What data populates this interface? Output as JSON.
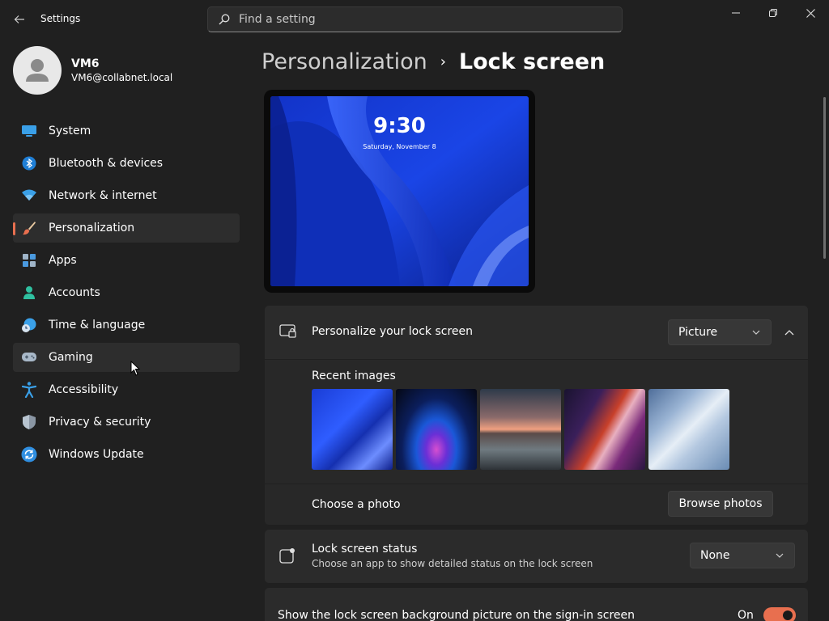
{
  "app": {
    "title": "Settings"
  },
  "search": {
    "placeholder": "Find a setting"
  },
  "user": {
    "name": "VM6",
    "email": "VM6@collabnet.local"
  },
  "sidebar": {
    "items": [
      {
        "label": "System",
        "icon": "system-icon",
        "selected": false
      },
      {
        "label": "Bluetooth & devices",
        "icon": "bluetooth-icon",
        "selected": false
      },
      {
        "label": "Network & internet",
        "icon": "wifi-icon",
        "selected": false
      },
      {
        "label": "Personalization",
        "icon": "brush-icon",
        "selected": true
      },
      {
        "label": "Apps",
        "icon": "apps-icon",
        "selected": false
      },
      {
        "label": "Accounts",
        "icon": "accounts-icon",
        "selected": false
      },
      {
        "label": "Time & language",
        "icon": "time-language-icon",
        "selected": false
      },
      {
        "label": "Gaming",
        "icon": "gamepad-icon",
        "selected": false
      },
      {
        "label": "Accessibility",
        "icon": "accessibility-icon",
        "selected": false
      },
      {
        "label": "Privacy & security",
        "icon": "shield-icon",
        "selected": false
      },
      {
        "label": "Windows Update",
        "icon": "update-icon",
        "selected": false
      }
    ]
  },
  "breadcrumb": {
    "parent": "Personalization",
    "separator": "›",
    "current": "Lock screen"
  },
  "preview": {
    "time": "9:30",
    "date": "Saturday, November 8"
  },
  "personalize": {
    "title": "Personalize your lock screen",
    "selected_option": "Picture",
    "recent_images_label": "Recent images",
    "recent_images": [
      "bloom-blue",
      "glow-dark",
      "sunset-lake",
      "ribbon-purple",
      "bloom-light"
    ],
    "choose_photo_label": "Choose a photo",
    "browse_button": "Browse photos"
  },
  "status": {
    "title": "Lock screen status",
    "subtitle": "Choose an app to show detailed status on the lock screen",
    "selected_option": "None"
  },
  "signin": {
    "title": "Show the lock screen background picture on the sign-in screen",
    "toggle_label": "On",
    "toggle_on": true
  },
  "colors": {
    "accent": "#e86f4f",
    "background": "#202020",
    "card": "#2b2b2b"
  }
}
